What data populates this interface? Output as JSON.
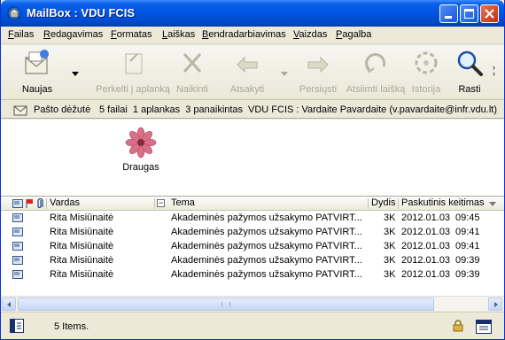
{
  "window": {
    "title": "MailBox : VDU FCIS"
  },
  "menu": [
    {
      "text": "Failas",
      "ul": "F",
      "rest": "ailas"
    },
    {
      "text": "Redagavimas",
      "ul": "R",
      "rest": "edagavimas"
    },
    {
      "text": "Formatas",
      "ul": "F",
      "rest": "ormatas"
    },
    {
      "text": "Laiškas",
      "ul": "L",
      "rest": "aiškas"
    },
    {
      "text": "Bendradarbiavimas",
      "ul": "B",
      "rest": "endradarbiavimas"
    },
    {
      "text": "Vaizdas",
      "ul": "V",
      "rest": "aizdas"
    },
    {
      "text": "Pagalba",
      "ul": "P",
      "rest": "agalba"
    }
  ],
  "toolbar": {
    "new": "Naujas",
    "move": "Perkelti į aplanką",
    "delete": "Naikinti",
    "reply": "Atsakyti",
    "forward": "Persiųsti",
    "recall": "Atsiimti laišką",
    "history": "Istorija",
    "find": "Rasti"
  },
  "location": {
    "folder": "Pašto dėžutė",
    "stats": "5 failai  1 aplankas  3 panaikintas",
    "account": "VDU FCIS : Vardaite Pavardaite (v.pavardaite@infr.vdu.lt)"
  },
  "folders": [
    {
      "name": "Draugas"
    }
  ],
  "columns": {
    "from": "Vardas",
    "subject": "Tema",
    "size": "Dydis",
    "modified": "Paskutinis keitimas"
  },
  "messages": [
    {
      "from": "Rita Misiūnaitė",
      "subject": "Akademinės pažymos užsakymo PATVIRT...",
      "size": "3K",
      "date": "2012.01.03",
      "time": "09:45"
    },
    {
      "from": "Rita Misiūnaitė",
      "subject": "Akademinės pažymos užsakymo PATVIRT...",
      "size": "3K",
      "date": "2012.01.03",
      "time": "09:41"
    },
    {
      "from": "Rita Misiūnaitė",
      "subject": "Akademinės pažymos užsakymo PATVIRT...",
      "size": "3K",
      "date": "2012.01.03",
      "time": "09:41"
    },
    {
      "from": "Rita Misiūnaitė",
      "subject": "Akademinės pažymos užsakymo PATVIRT...",
      "size": "3K",
      "date": "2012.01.03",
      "time": "09:39"
    },
    {
      "from": "Rita Misiūnaitė",
      "subject": "Akademinės pažymos užsakymo PATVIRT...",
      "size": "3K",
      "date": "2012.01.03",
      "time": "09:39"
    }
  ],
  "status": {
    "items": "5 Items."
  },
  "colors": {
    "titlebar": "#0054e3",
    "accent": "#1657d9"
  }
}
